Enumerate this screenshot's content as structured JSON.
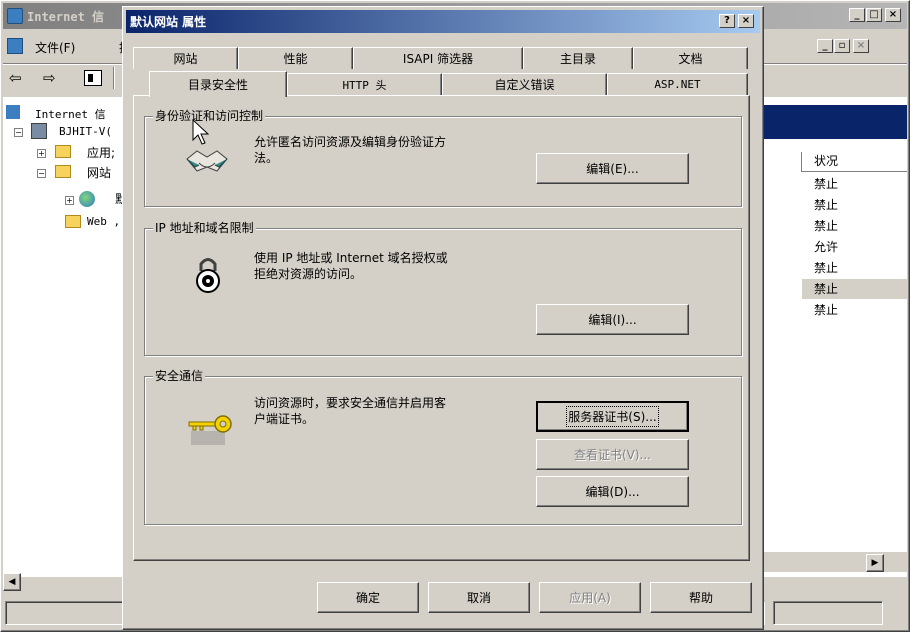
{
  "main_window": {
    "title": "Internet 信",
    "menu": {
      "file": "文件(F)",
      "action": "操"
    },
    "toolbar": {
      "back": "⇦",
      "forward": "⇨"
    },
    "tree": {
      "root": "Internet 信",
      "server": "BJHIT-V(",
      "app_pools": "应用;",
      "websites": "网站",
      "default_site": "默",
      "web_ext": "Web ,"
    },
    "list": {
      "header_status": "状况",
      "rows": [
        "禁止",
        "禁止",
        "禁止",
        "允许",
        "禁止",
        "禁止",
        "禁止"
      ],
      "selected_index": 5
    }
  },
  "dialog": {
    "title": "默认网站 属性",
    "help_btn": "?",
    "close_btn": "×",
    "tabs_back": [
      "网站",
      "性能",
      "ISAPI 筛选器",
      "主目录",
      "文档"
    ],
    "tabs_front": [
      "目录安全性",
      "HTTP 头",
      "自定义错误",
      "ASP.NET"
    ],
    "active_tab": "目录安全性",
    "groups": {
      "auth": {
        "legend": "身份验证和访问控制",
        "line1": "允许匿名访问资源及编辑身份验证方",
        "line2": "法。",
        "edit_btn": "编辑(E)..."
      },
      "ip": {
        "legend": "IP 地址和域名限制",
        "line1": "使用 IP 地址或 Internet 域名授权或",
        "line2": "拒绝对资源的访问。",
        "edit_btn": "编辑(I)..."
      },
      "secure": {
        "legend": "安全通信",
        "line1": "访问资源时，要求安全通信并启用客",
        "line2": "户端证书。",
        "server_cert_btn": "服务器证书(S)...",
        "view_cert_btn": "查看证书(V)...",
        "edit_btn": "编辑(D)..."
      }
    },
    "footer": {
      "ok": "确定",
      "cancel": "取消",
      "apply": "应用(A)",
      "help": "帮助"
    }
  },
  "colors": {
    "title_active": "#0a246a",
    "title_inactive": "#808080",
    "face": "#d4d0c8",
    "desktop": "#3a6ea5",
    "selection_row": "#d4d0c8"
  }
}
